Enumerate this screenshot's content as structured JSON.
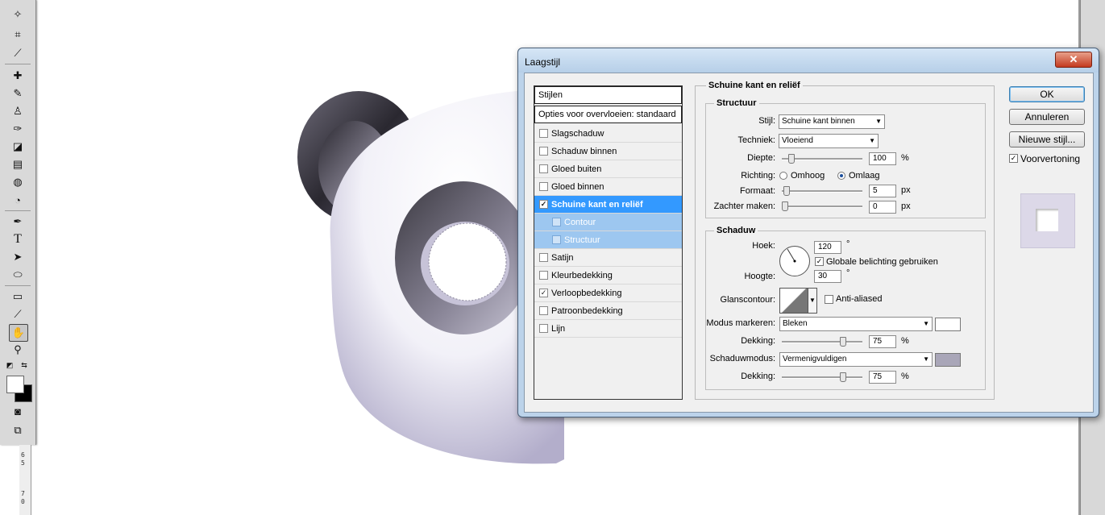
{
  "dialog": {
    "title": "Laagstijl",
    "close_glyph": "✕",
    "buttons": {
      "ok": "OK",
      "cancel": "Annuleren",
      "new_style": "Nieuwe stijl..."
    },
    "preview_label": "Voorvertoning",
    "preview_checked": true
  },
  "style_list": {
    "header": "Stijlen",
    "blend_options": "Opties voor overvloeien: standaard",
    "items": [
      {
        "label": "Slagschaduw",
        "checked": false
      },
      {
        "label": "Schaduw binnen",
        "checked": false
      },
      {
        "label": "Gloed buiten",
        "checked": false
      },
      {
        "label": "Gloed binnen",
        "checked": false
      },
      {
        "label": "Schuine kant en reliëf",
        "checked": true,
        "selected": true
      },
      {
        "label": "Contour",
        "checked": false,
        "sub": true
      },
      {
        "label": "Structuur",
        "checked": false,
        "sub": true
      },
      {
        "label": "Satijn",
        "checked": false
      },
      {
        "label": "Kleurbedekking",
        "checked": false
      },
      {
        "label": "Verloopbedekking",
        "checked": true
      },
      {
        "label": "Patroonbedekking",
        "checked": false
      },
      {
        "label": "Lijn",
        "checked": false
      }
    ]
  },
  "bevel": {
    "section_title": "Schuine kant en reliëf",
    "structure": {
      "title": "Structuur",
      "style_label": "Stijl:",
      "style_value": "Schuine kant binnen",
      "technique_label": "Techniek:",
      "technique_value": "Vloeiend",
      "depth_label": "Diepte:",
      "depth_value": "100",
      "depth_unit": "%",
      "direction_label": "Richting:",
      "direction_up": "Omhoog",
      "direction_down": "Omlaag",
      "direction_selected": "Omlaag",
      "size_label": "Formaat:",
      "size_value": "5",
      "size_unit": "px",
      "soften_label": "Zachter maken:",
      "soften_value": "0",
      "soften_unit": "px"
    },
    "shading": {
      "title": "Schaduw",
      "angle_label": "Hoek:",
      "angle_value": "120",
      "angle_unit": "°",
      "global_light_label": "Globale belichting gebruiken",
      "global_light_checked": true,
      "altitude_label": "Hoogte:",
      "altitude_value": "30",
      "altitude_unit": "°",
      "gloss_label": "Glanscontour:",
      "anti_aliased_label": "Anti-aliased",
      "anti_aliased_checked": false,
      "highlight_mode_label": "Modus markeren:",
      "highlight_mode_value": "Bleken",
      "highlight_color": "#ffffff",
      "highlight_opacity_label": "Dekking:",
      "highlight_opacity_value": "75",
      "highlight_opacity_unit": "%",
      "shadow_mode_label": "Schaduwmodus:",
      "shadow_mode_value": "Vermenigvuldigen",
      "shadow_color": "#a9a6b8",
      "shadow_opacity_label": "Dekking:",
      "shadow_opacity_value": "75",
      "shadow_opacity_unit": "%"
    }
  },
  "toolbar": {
    "tools": [
      "magic-wand-icon",
      "crop-icon",
      "slice-icon",
      "healing-brush-icon",
      "brush-icon",
      "clone-stamp-icon",
      "history-brush-icon",
      "eraser-icon",
      "gradient-icon",
      "blur-icon",
      "dodge-icon",
      "pen-icon",
      "type-icon",
      "path-select-icon",
      "ellipse-icon",
      "notes-icon",
      "eyedropper-icon",
      "hand-icon",
      "zoom-icon"
    ],
    "type_glyph": "T"
  },
  "ruler": {
    "marks": [
      "6",
      "5",
      "7",
      "0"
    ]
  }
}
